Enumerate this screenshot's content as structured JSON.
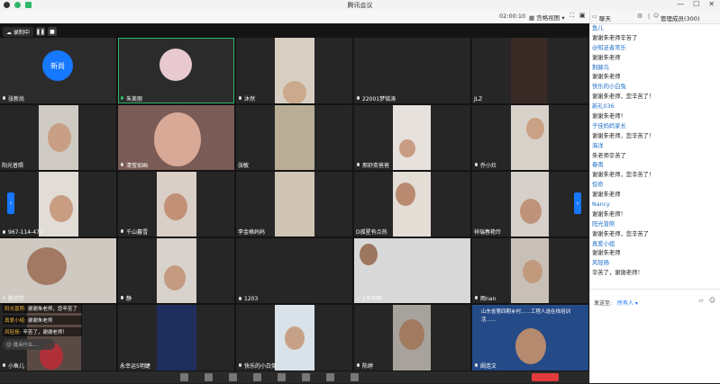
{
  "window": {
    "title": "腾讯会议",
    "controls": [
      "—",
      "☐",
      "✕"
    ]
  },
  "toolbar": {
    "timer": "02:00:10",
    "view_label": "宫格视图",
    "view_arrow": "▾"
  },
  "recording": {
    "label": "录制中",
    "pause": "❚❚",
    "stop": "■"
  },
  "nav": {
    "left": "‹",
    "right": "›"
  },
  "tiles": [
    {
      "name": "张新尚",
      "avatar_text": "新尚"
    },
    {
      "name": "朱美丽"
    },
    {
      "name": "沐然"
    },
    {
      "name": "22001梦铭涛"
    },
    {
      "name": "JLZ"
    },
    {
      "name": "阳光普照"
    },
    {
      "name": "清莹如画"
    },
    {
      "name": "张敏"
    },
    {
      "name": "邢舒奕爸爸"
    },
    {
      "name": "乔小灶"
    },
    {
      "name": "967-114-477"
    },
    {
      "name": "千山暮雪"
    },
    {
      "name": "李金格妈妈"
    },
    {
      "name": "D孤星有点热"
    },
    {
      "name": "祥瑞春艳玲"
    },
    {
      "name": "陈宗学"
    },
    {
      "name": "静"
    },
    {
      "name": "1203"
    },
    {
      "name": "1于中明"
    },
    {
      "name": "雨nan"
    },
    {
      "name": "小鱼儿"
    },
    {
      "name": "永幸运5明婕"
    },
    {
      "name": "快乐的小白兔"
    },
    {
      "name": "陈婷"
    },
    {
      "name": "阚连文",
      "screen_text": "山东省第四期乡村……工程人选在线培训活……"
    }
  ],
  "overlay_chat": [
    {
      "user": "阳光普照:",
      "text": "谢谢朱老师，您辛苦了"
    },
    {
      "user": "真爱小组:",
      "text": "谢谢朱老师"
    },
    {
      "user": "风轻扬:",
      "text": "辛苦了，谢谢老师！"
    }
  ],
  "overlay_input": "说点什么...",
  "chat_panel": {
    "tab_chat": "聊天",
    "separator": "|",
    "tab_members": "管理成员(300)",
    "lines": [
      {
        "text": "鱼儿",
        "sender": true
      },
      {
        "text": "谢谢朱老师辛苦了",
        "sender": false
      },
      {
        "text": "@知足者常乐",
        "sender": true
      },
      {
        "text": "谢谢朱老师",
        "sender": false
      },
      {
        "text": "荆棘鸟",
        "sender": true
      },
      {
        "text": "谢谢朱老师",
        "sender": false
      },
      {
        "text": "快乐的小白兔",
        "sender": true
      },
      {
        "text": "谢谢朱老师，您辛苦了！",
        "sender": false
      },
      {
        "text": "新礼036",
        "sender": true
      },
      {
        "text": "谢谢朱老师！",
        "sender": false
      },
      {
        "text": "子佳妈妈家长",
        "sender": true
      },
      {
        "text": "谢谢朱老师，您辛苦了！",
        "sender": false
      },
      {
        "text": "海洋",
        "sender": true
      },
      {
        "text": "朱老师辛苦了",
        "sender": false
      },
      {
        "text": "春雨",
        "sender": true
      },
      {
        "text": "谢谢朱老师，您辛苦了！",
        "sender": false
      },
      {
        "text": "惊奇",
        "sender": true
      },
      {
        "text": "谢谢朱老师",
        "sender": false
      },
      {
        "text": "Nancy",
        "sender": true
      },
      {
        "text": "谢谢朱老师！",
        "sender": false
      },
      {
        "text": "阳光普照",
        "sender": true
      },
      {
        "text": "谢谢朱老师，您辛苦了",
        "sender": false
      },
      {
        "text": "真爱小组",
        "sender": true
      },
      {
        "text": "谢谢朱老师",
        "sender": false
      },
      {
        "text": "风轻扬",
        "sender": true
      },
      {
        "text": "辛苦了，谢谢老师！",
        "sender": false
      }
    ],
    "send_to_label": "发送至:",
    "send_to_value": "所有人 ▾"
  },
  "colors": {
    "accent": "#1677ff",
    "active_border": "#2fb66a",
    "chat_sender": "#1c6ec7"
  }
}
